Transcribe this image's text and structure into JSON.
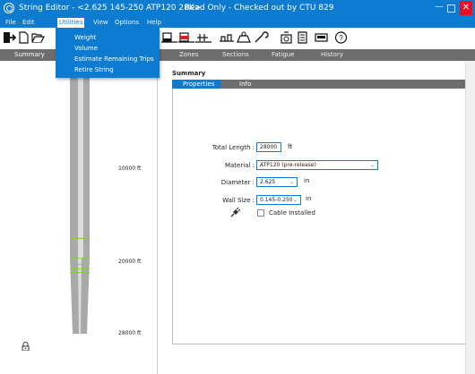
{
  "titlebar": {
    "title": "String Editor - <2.625 145-250 ATP120 28K>",
    "status": "Read Only - Checked out by CTU 829",
    "minimize": "—",
    "close": "✕"
  },
  "menu": {
    "items": [
      "File",
      "Edit",
      "Utilities",
      "View",
      "Options",
      "Help"
    ],
    "active": "Utilities"
  },
  "dropdown": {
    "items": [
      "Weight",
      "Volume",
      "Estimate Remaining Trips",
      "Retire String"
    ]
  },
  "nav": {
    "items": [
      "Summary",
      "Zones",
      "Sections",
      "Fatigue",
      "History"
    ]
  },
  "left": {
    "depths": [
      "10000 ft",
      "20000 ft",
      "28000 ft"
    ]
  },
  "summary": {
    "title": "Summary",
    "tabs": [
      "Properties",
      "Info"
    ],
    "total_length_label": "Total Length :",
    "total_length_value": "28000",
    "total_length_unit": "ft",
    "material_label": "Material :",
    "material_value": "ATP120 (pre-release)",
    "diameter_label": "Diameter :",
    "diameter_value": "2.625",
    "diameter_unit": "in",
    "wall_size_label": "Wall Size :",
    "wall_size_value": "0.145-0.250",
    "wall_size_unit": "in",
    "cable_label": "Cable Installed"
  },
  "colors": {
    "accent": "#0d7bd0",
    "nav_bg": "#6d6d6d",
    "close": "#e81123"
  },
  "icons": [
    "app-icon",
    "exit-icon",
    "new-document-icon",
    "open-folder-icon",
    "string-tool-icon",
    "zones-tool-icon",
    "sections-tool-icon",
    "fatigue-tool-icon",
    "weight-icon",
    "report-icon",
    "message-icon",
    "help-icon",
    "lock-icon",
    "plug-icon"
  ]
}
